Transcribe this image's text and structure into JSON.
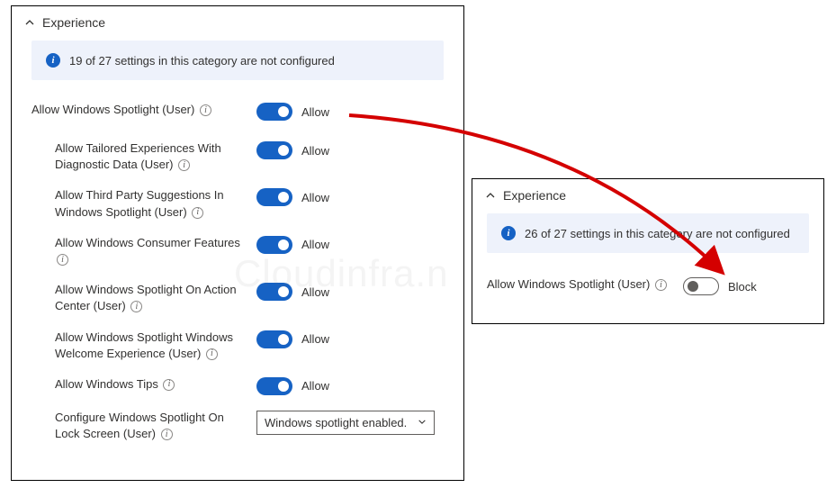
{
  "left": {
    "section_title": "Experience",
    "banner_text": "19 of 27 settings in this category are not configured",
    "settings": [
      {
        "label_pre": "Allow Windows Spotlight (User) ",
        "state": "Allow"
      },
      {
        "label_pre": "Allow Tailored Experiences With Diagnostic Data (User) ",
        "state": "Allow"
      },
      {
        "label_pre": "Allow Third Party Suggestions In Windows Spotlight (User) ",
        "state": "Allow"
      },
      {
        "label_pre": "Allow Windows Consumer Features ",
        "state": "Allow"
      },
      {
        "label_pre": "Allow Windows Spotlight On Action Center (User) ",
        "state": "Allow"
      },
      {
        "label_pre": "Allow Windows Spotlight Windows Welcome Experience (User) ",
        "state": "Allow"
      },
      {
        "label_pre": "Allow Windows Tips ",
        "state": "Allow"
      }
    ],
    "config_spotlight_label": "Configure Windows Spotlight On Lock Screen (User) ",
    "config_spotlight_value": "Windows spotlight enabled."
  },
  "right": {
    "section_title": "Experience",
    "banner_text": "26 of 27 settings in this category are not configured",
    "setting_label": "Allow Windows Spotlight (User) ",
    "setting_state": "Block"
  },
  "watermark": "Cloudinfra.n"
}
